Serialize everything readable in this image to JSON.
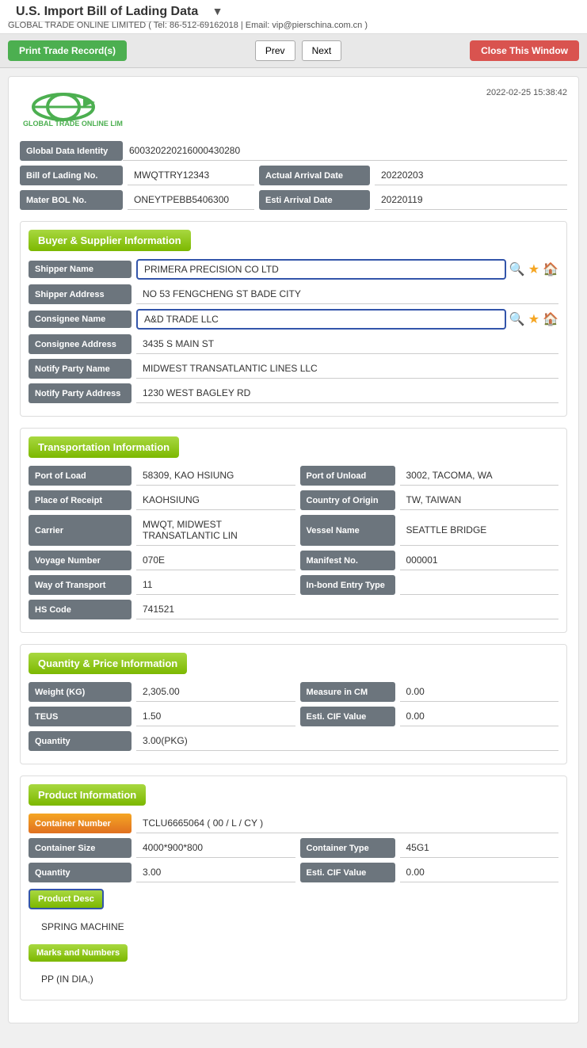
{
  "page": {
    "title": "U.S. Import Bill of Lading Data",
    "subtitle": "GLOBAL TRADE ONLINE LIMITED ( Tel: 86-512-69162018 | Email: vip@pierschina.com.cn )",
    "timestamp": "2022-02-25 15:38:42"
  },
  "toolbar": {
    "print_label": "Print Trade Record(s)",
    "prev_label": "Prev",
    "next_label": "Next",
    "close_label": "Close This Window"
  },
  "record": {
    "global_data_identity_label": "Global Data Identity",
    "global_data_identity_value": "600320220216000430280",
    "bill_of_lading_label": "Bill of Lading No.",
    "bill_of_lading_value": "MWQTTRY12343",
    "actual_arrival_date_label": "Actual Arrival Date",
    "actual_arrival_date_value": "20220203",
    "master_bol_label": "Mater BOL No.",
    "master_bol_value": "ONEYTPEBB5406300",
    "esti_arrival_date_label": "Esti Arrival Date",
    "esti_arrival_date_value": "20220119"
  },
  "buyer_supplier": {
    "section_title": "Buyer & Supplier Information",
    "shipper_name_label": "Shipper Name",
    "shipper_name_value": "PRIMERA PRECISION CO LTD",
    "shipper_address_label": "Shipper Address",
    "shipper_address_value": "NO 53 FENGCHENG ST BADE CITY",
    "consignee_name_label": "Consignee Name",
    "consignee_name_value": "A&D TRADE LLC",
    "consignee_address_label": "Consignee Address",
    "consignee_address_value": "3435 S MAIN ST",
    "notify_party_name_label": "Notify Party Name",
    "notify_party_name_value": "MIDWEST TRANSATLANTIC LINES LLC",
    "notify_party_address_label": "Notify Party Address",
    "notify_party_address_value": "1230 WEST BAGLEY RD"
  },
  "transportation": {
    "section_title": "Transportation Information",
    "port_of_load_label": "Port of Load",
    "port_of_load_value": "58309, KAO HSIUNG",
    "port_of_unload_label": "Port of Unload",
    "port_of_unload_value": "3002, TACOMA, WA",
    "place_of_receipt_label": "Place of Receipt",
    "place_of_receipt_value": "KAOHSIUNG",
    "country_of_origin_label": "Country of Origin",
    "country_of_origin_value": "TW, TAIWAN",
    "carrier_label": "Carrier",
    "carrier_value": "MWQT, MIDWEST TRANSATLANTIC LIN",
    "vessel_name_label": "Vessel Name",
    "vessel_name_value": "SEATTLE BRIDGE",
    "voyage_number_label": "Voyage Number",
    "voyage_number_value": "070E",
    "manifest_no_label": "Manifest No.",
    "manifest_no_value": "000001",
    "way_of_transport_label": "Way of Transport",
    "way_of_transport_value": "11",
    "in_bond_entry_type_label": "In-bond Entry Type",
    "in_bond_entry_type_value": "",
    "hs_code_label": "HS Code",
    "hs_code_value": "741521"
  },
  "quantity_price": {
    "section_title": "Quantity & Price Information",
    "weight_label": "Weight (KG)",
    "weight_value": "2,305.00",
    "measure_label": "Measure in CM",
    "measure_value": "0.00",
    "teus_label": "TEUS",
    "teus_value": "1.50",
    "esti_cif_label": "Esti. CIF Value",
    "esti_cif_value": "0.00",
    "quantity_label": "Quantity",
    "quantity_value": "3.00(PKG)"
  },
  "product": {
    "section_title": "Product Information",
    "container_number_label": "Container Number",
    "container_number_value": "TCLU6665064 ( 00 / L / CY )",
    "container_size_label": "Container Size",
    "container_size_value": "4000*900*800",
    "container_type_label": "Container Type",
    "container_type_value": "45G1",
    "quantity_label": "Quantity",
    "quantity_value": "3.00",
    "esti_cif_label": "Esti. CIF Value",
    "esti_cif_value": "0.00",
    "product_desc_label": "Product Desc",
    "product_desc_value": "SPRING MACHINE",
    "marks_numbers_label": "Marks and Numbers",
    "marks_numbers_value": "PP (IN DIA,)"
  }
}
